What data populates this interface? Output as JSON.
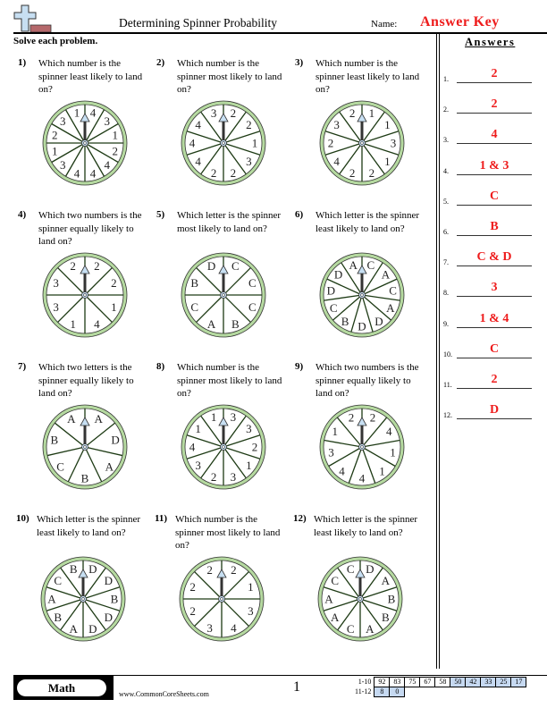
{
  "header": {
    "title": "Determining Spinner Probability",
    "name_label": "Name:",
    "answer_key": "Answer Key",
    "instructions": "Solve each problem."
  },
  "colors": {
    "answer_red": "#ee1c1c",
    "spinner_ring": "#b5d9a0",
    "spinner_line": "#1d3a14",
    "arrow_fill": "#c7dff2",
    "logo_cross": "#c7dff2",
    "logo_bar": "#b5686b",
    "score_shade": "#c6d9f1"
  },
  "problems": [
    {
      "num": "1)",
      "text": "Which number is the spinner least likely to land on?",
      "sectors": [
        "4",
        "3",
        "1",
        "2",
        "4",
        "4",
        "4",
        "3",
        "1",
        "2",
        "3",
        "1"
      ]
    },
    {
      "num": "2)",
      "text": "Which number is the spinner most likely to land on?",
      "sectors": [
        "2",
        "2",
        "1",
        "3",
        "2",
        "2",
        "4",
        "4",
        "4",
        "3"
      ]
    },
    {
      "num": "3)",
      "text": "Which number is the spinner least likely to land on?",
      "sectors": [
        "1",
        "1",
        "3",
        "1",
        "2",
        "2",
        "4",
        "2",
        "3",
        "2"
      ]
    },
    {
      "num": "4)",
      "text": "Which two numbers is the spinner equally likely to land on?",
      "sectors": [
        "2",
        "2",
        "1",
        "4",
        "1",
        "3",
        "3",
        "2"
      ]
    },
    {
      "num": "5)",
      "text": "Which letter is the spinner most likely to land on?",
      "sectors": [
        "C",
        "C",
        "C",
        "B",
        "A",
        "C",
        "B",
        "D"
      ]
    },
    {
      "num": "6)",
      "text": "Which letter is the spinner least likely to land on?",
      "sectors": [
        "C",
        "A",
        "C",
        "A",
        "D",
        "D",
        "B",
        "C",
        "D",
        "D",
        "A"
      ]
    },
    {
      "num": "7)",
      "text": "Which two letters is the spinner equally likely to land on?",
      "sectors": [
        "A",
        "D",
        "A",
        "B",
        "C",
        "B",
        "A"
      ]
    },
    {
      "num": "8)",
      "text": "Which number is the spinner most likely to land on?",
      "sectors": [
        "3",
        "3",
        "2",
        "1",
        "3",
        "2",
        "3",
        "4",
        "1",
        "1"
      ]
    },
    {
      "num": "9)",
      "text": "Which two numbers is the spinner equally likely to land on?",
      "sectors": [
        "2",
        "4",
        "1",
        "1",
        "4",
        "4",
        "3",
        "1",
        "2"
      ]
    },
    {
      "num": "10)",
      "text": "Which letter is the spinner least likely to land on?",
      "sectors": [
        "D",
        "D",
        "B",
        "D",
        "D",
        "A",
        "B",
        "A",
        "C",
        "B"
      ]
    },
    {
      "num": "11)",
      "text": "Which number is the spinner most likely to land on?",
      "sectors": [
        "2",
        "1",
        "3",
        "4",
        "3",
        "2",
        "2",
        "2"
      ]
    },
    {
      "num": "12)",
      "text": "Which letter is the spinner least likely to land on?",
      "sectors": [
        "D",
        "A",
        "B",
        "B",
        "A",
        "C",
        "A",
        "A",
        "C",
        "C"
      ]
    }
  ],
  "answers": {
    "title": "Answers",
    "items": [
      {
        "num": "1.",
        "value": "2"
      },
      {
        "num": "2.",
        "value": "2"
      },
      {
        "num": "3.",
        "value": "4"
      },
      {
        "num": "4.",
        "value": "1 & 3"
      },
      {
        "num": "5.",
        "value": "C"
      },
      {
        "num": "6.",
        "value": "B"
      },
      {
        "num": "7.",
        "value": "C & D"
      },
      {
        "num": "8.",
        "value": "3"
      },
      {
        "num": "9.",
        "value": "1 & 4"
      },
      {
        "num": "10.",
        "value": "C"
      },
      {
        "num": "11.",
        "value": "2"
      },
      {
        "num": "12.",
        "value": "D"
      }
    ]
  },
  "footer": {
    "subject": "Math",
    "site": "www.CommonCoreSheets.com",
    "page": "1",
    "score_rows": [
      {
        "label": "1-10",
        "values": [
          "92",
          "83",
          "75",
          "67",
          "58",
          "50",
          "42",
          "33",
          "25",
          "17"
        ],
        "shaded_from": 5
      },
      {
        "label": "11-12",
        "values": [
          "8",
          "0"
        ],
        "shaded_from": 0
      }
    ]
  }
}
